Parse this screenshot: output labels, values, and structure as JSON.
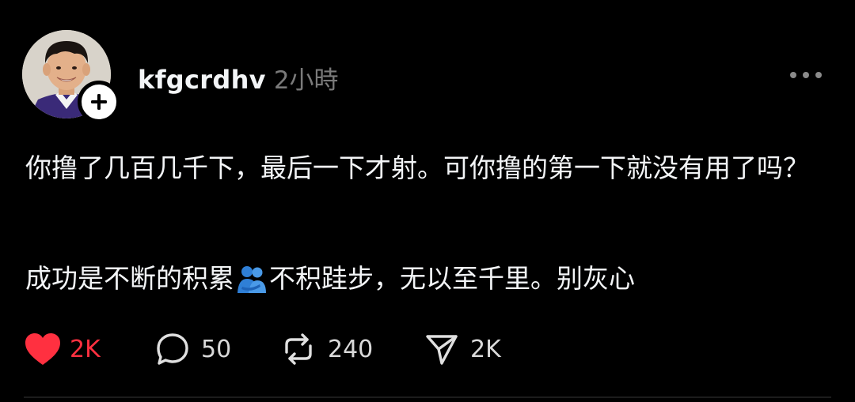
{
  "post": {
    "username": "kfgcrdhv",
    "time": "2小時",
    "paragraph1": "你撸了几百几千下，最后一下才射。可你撸的第一下就没有用了吗？",
    "paragraph2_before": "成功是不断的积累",
    "paragraph2_after": "不积跬步，无以至千里。别灰心",
    "inline_emoji": "people-hugging-icon"
  },
  "actions": {
    "likes": "2K",
    "comments": "50",
    "reposts": "240",
    "shares": "2K"
  },
  "icons": {
    "like": "heart-icon",
    "comment": "comment-bubble-icon",
    "repost": "repost-icon",
    "share": "send-icon",
    "more": "more-dots-icon",
    "follow": "plus-icon"
  },
  "colors": {
    "background": "#000000",
    "text": "#f3f5f7",
    "muted": "#7a7a7a",
    "like": "#ff3040"
  }
}
